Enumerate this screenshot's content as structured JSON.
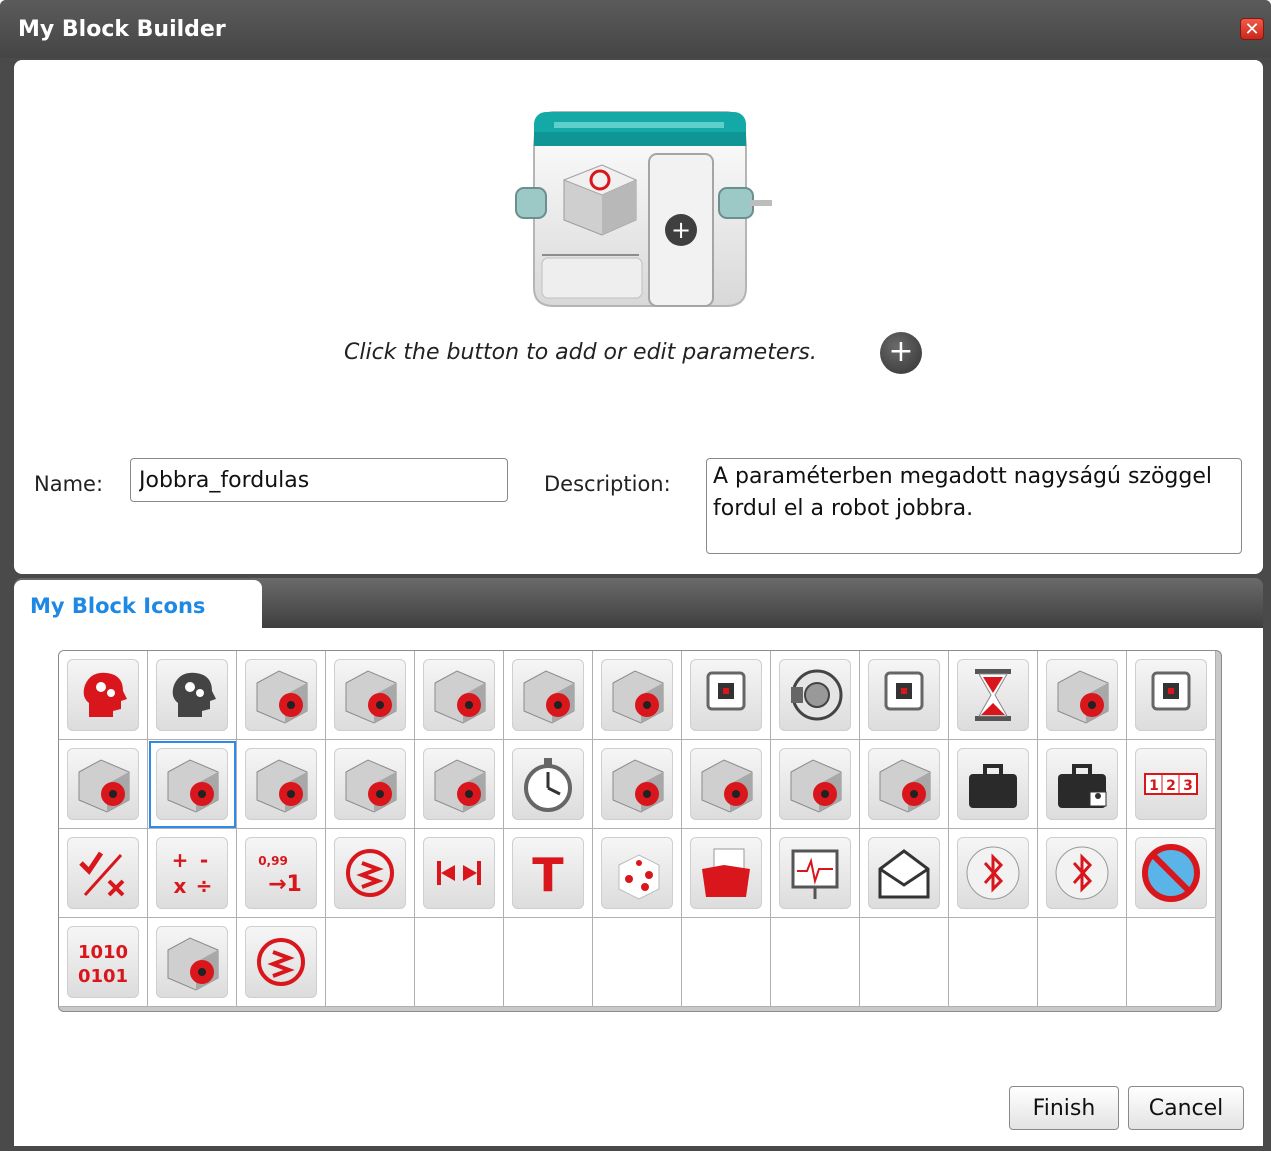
{
  "window": {
    "title": "My Block Builder",
    "close_symbol": "✕"
  },
  "preview": {
    "instruction": "Click the button to add or edit parameters.",
    "add_symbol": "+"
  },
  "form": {
    "name_label": "Name:",
    "name_value": "Jobbra_fordulas",
    "description_label": "Description:",
    "description_value": "A paraméterben megadott nagyságú szöggel fordul el a robot jobbra."
  },
  "tabs": [
    {
      "label": "My Block Icons"
    }
  ],
  "icon_grid": {
    "rows": 4,
    "columns": 13,
    "selected_index": 14,
    "icons": [
      "brain-gears-red-icon",
      "brain-gears-gray-icon",
      "medium-motor-icon",
      "large-motor-icon",
      "move-tank-icon",
      "move-steering-icon",
      "motor-control-icon",
      "brick-display-icon",
      "sound-speaker-icon",
      "brick-buttons-icon",
      "hourglass-icon",
      "loop-interrupt-icon",
      "brick-status-light-icon",
      "ultrasonic-sensor-icon",
      "gyro-sensor-icon",
      "infrared-sensor-icon",
      "motor-rotation-icon",
      "medium-motor-rotation-icon",
      "timer-icon",
      "touch-sensor-icon",
      "color-sensor-icon",
      "nxt-sound-sensor-icon",
      "temperature-sensor-icon",
      "briefcase-icon",
      "briefcase-lock-icon",
      "array-123-icon",
      "logic-operations-icon",
      "math-icon",
      "round-icon",
      "compare-icon",
      "range-icon",
      "text-icon",
      "random-dice-icon",
      "file-access-icon",
      "data-logging-icon",
      "messaging-envelope-icon",
      "bluetooth-icon",
      "bluetooth-wrench-icon",
      "sleep-stop-icon",
      "binary-data-icon",
      "unregulated-motor-icon",
      "compare-alt-icon"
    ],
    "labels": {
      "math": [
        "+",
        "-",
        "x",
        "÷"
      ],
      "round": [
        "0,99",
        "→1"
      ],
      "binary": [
        "1010",
        "0101"
      ],
      "array": [
        "1",
        "2",
        "3"
      ],
      "text": "T"
    }
  },
  "buttons": {
    "finish": "Finish",
    "cancel": "Cancel"
  },
  "colors": {
    "accent_red": "#d8161b",
    "tab_blue": "#1e88e5",
    "block_teal": "#12a3a3"
  }
}
